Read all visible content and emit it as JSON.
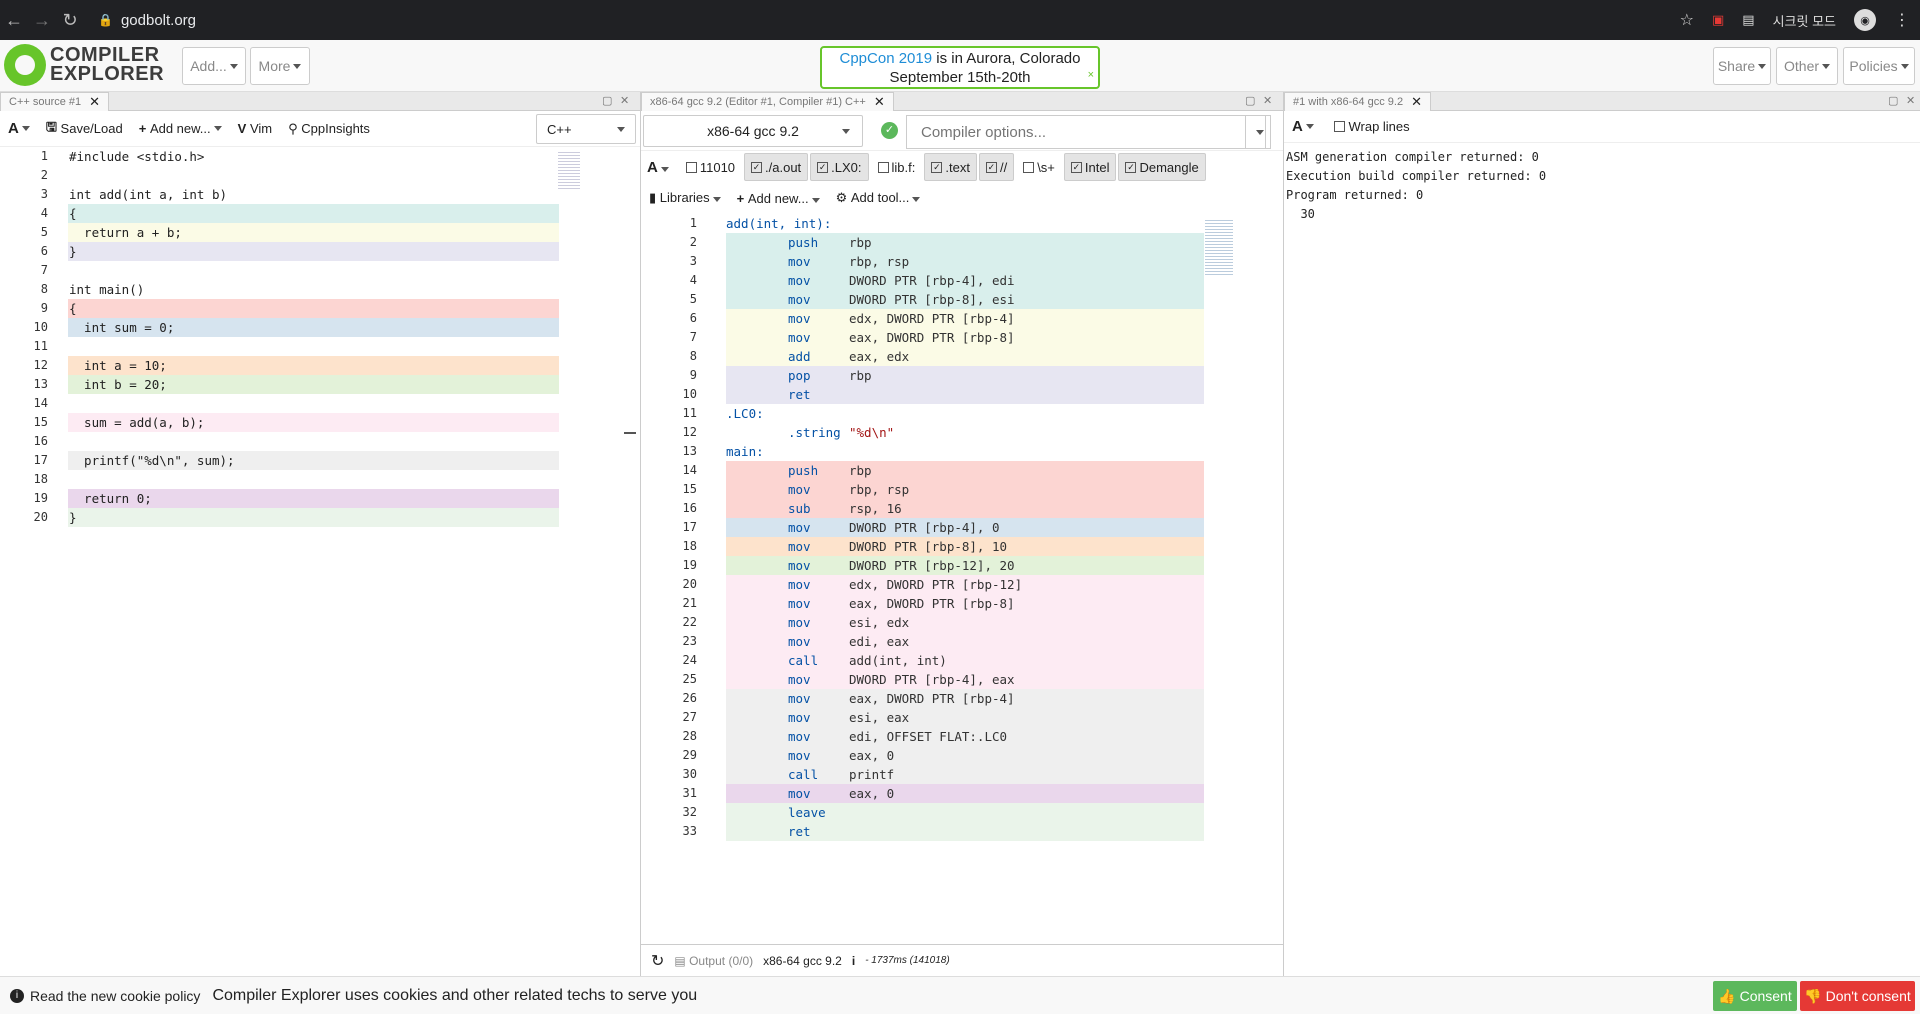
{
  "browser": {
    "url": "godbolt.org",
    "profile": "시크릿 모드"
  },
  "header": {
    "logo_top": "COMPILER",
    "logo_bottom": "EXPLORER",
    "add": "Add...",
    "more": "More",
    "banner_link": "CppCon 2019",
    "banner_rest": " is in Aurora, Colorado",
    "banner_line2": "September 15th-20th",
    "banner_close": "×",
    "share": "Share",
    "other": "Other",
    "policies": "Policies"
  },
  "source": {
    "tab": "C++ source #1",
    "font": "A",
    "save": "Save/Load",
    "addnew": "Add new...",
    "vim": "Vim",
    "insights": "CppInsights",
    "lang": "C++",
    "lines": [
      {
        "n": "1",
        "t": "#include <stdio.h>",
        "bg": ""
      },
      {
        "n": "2",
        "t": "",
        "bg": ""
      },
      {
        "n": "3",
        "t": "int add(int a, int b)",
        "bg": ""
      },
      {
        "n": "4",
        "t": "{",
        "bg": "#d9efec"
      },
      {
        "n": "5",
        "t": "  return a + b;",
        "bg": "#fbfbe6"
      },
      {
        "n": "6",
        "t": "}",
        "bg": "#e7e6f2"
      },
      {
        "n": "7",
        "t": "",
        "bg": ""
      },
      {
        "n": "8",
        "t": "int main()",
        "bg": ""
      },
      {
        "n": "9",
        "t": "{",
        "bg": "#fcd5d2"
      },
      {
        "n": "10",
        "t": "  int sum = 0;",
        "bg": "#d6e4ef"
      },
      {
        "n": "11",
        "t": "",
        "bg": ""
      },
      {
        "n": "12",
        "t": "  int a = 10;",
        "bg": "#fde3cc"
      },
      {
        "n": "13",
        "t": "  int b = 20;",
        "bg": "#e3f2d9"
      },
      {
        "n": "14",
        "t": "",
        "bg": ""
      },
      {
        "n": "15",
        "t": "  sum = add(a, b);",
        "bg": "#fdebf3"
      },
      {
        "n": "16",
        "t": "",
        "bg": ""
      },
      {
        "n": "17",
        "t": "  printf(\"%d\\n\", sum);",
        "bg": "#efefef"
      },
      {
        "n": "18",
        "t": "",
        "bg": ""
      },
      {
        "n": "19",
        "t": "  return 0;",
        "bg": "#ead7ec"
      },
      {
        "n": "20",
        "t": "}",
        "bg": "#eaf4ea"
      }
    ]
  },
  "compiler": {
    "tab": "x86-64 gcc 9.2 (Editor #1, Compiler #1) C++",
    "name": "x86-64 gcc 9.2",
    "options_placeholder": "Compiler options...",
    "filters": [
      {
        "label": "11010",
        "on": false
      },
      {
        "label": "./a.out",
        "on": true
      },
      {
        "label": ".LX0:",
        "on": true
      },
      {
        "label": "lib.f:",
        "on": false
      },
      {
        "label": ".text",
        "on": true
      },
      {
        "label": "//",
        "on": true
      },
      {
        "label": "\\s+",
        "on": false
      },
      {
        "label": "Intel",
        "on": true
      },
      {
        "label": "Demangle",
        "on": true
      }
    ],
    "libraries": "Libraries",
    "addnew": "Add new...",
    "addtool": "Add tool...",
    "asm": [
      {
        "n": "1",
        "l": "add(int, int):",
        "op": "",
        "a": "",
        "bg": ""
      },
      {
        "n": "2",
        "l": "",
        "op": "push",
        "a": "rbp",
        "bg": "#d9efec"
      },
      {
        "n": "3",
        "l": "",
        "op": "mov",
        "a": "rbp, rsp",
        "bg": "#d9efec"
      },
      {
        "n": "4",
        "l": "",
        "op": "mov",
        "a": "DWORD PTR [rbp-4], edi",
        "bg": "#d9efec"
      },
      {
        "n": "5",
        "l": "",
        "op": "mov",
        "a": "DWORD PTR [rbp-8], esi",
        "bg": "#d9efec"
      },
      {
        "n": "6",
        "l": "",
        "op": "mov",
        "a": "edx, DWORD PTR [rbp-4]",
        "bg": "#fbfbe6"
      },
      {
        "n": "7",
        "l": "",
        "op": "mov",
        "a": "eax, DWORD PTR [rbp-8]",
        "bg": "#fbfbe6"
      },
      {
        "n": "8",
        "l": "",
        "op": "add",
        "a": "eax, edx",
        "bg": "#fbfbe6"
      },
      {
        "n": "9",
        "l": "",
        "op": "pop",
        "a": "rbp",
        "bg": "#e7e6f2"
      },
      {
        "n": "10",
        "l": "",
        "op": "ret",
        "a": "",
        "bg": "#e7e6f2"
      },
      {
        "n": "11",
        "l": ".LC0:",
        "op": "",
        "a": "",
        "bg": ""
      },
      {
        "n": "12",
        "l": "",
        "op": ".string",
        "a": "\"%d\\n\"",
        "bg": ""
      },
      {
        "n": "13",
        "l": "main:",
        "op": "",
        "a": "",
        "bg": ""
      },
      {
        "n": "14",
        "l": "",
        "op": "push",
        "a": "rbp",
        "bg": "#fcd5d2"
      },
      {
        "n": "15",
        "l": "",
        "op": "mov",
        "a": "rbp, rsp",
        "bg": "#fcd5d2"
      },
      {
        "n": "16",
        "l": "",
        "op": "sub",
        "a": "rsp, 16",
        "bg": "#fcd5d2"
      },
      {
        "n": "17",
        "l": "",
        "op": "mov",
        "a": "DWORD PTR [rbp-4], 0",
        "bg": "#d6e4ef"
      },
      {
        "n": "18",
        "l": "",
        "op": "mov",
        "a": "DWORD PTR [rbp-8], 10",
        "bg": "#fde3cc"
      },
      {
        "n": "19",
        "l": "",
        "op": "mov",
        "a": "DWORD PTR [rbp-12], 20",
        "bg": "#e3f2d9"
      },
      {
        "n": "20",
        "l": "",
        "op": "mov",
        "a": "edx, DWORD PTR [rbp-12]",
        "bg": "#fdebf3"
      },
      {
        "n": "21",
        "l": "",
        "op": "mov",
        "a": "eax, DWORD PTR [rbp-8]",
        "bg": "#fdebf3"
      },
      {
        "n": "22",
        "l": "",
        "op": "mov",
        "a": "esi, edx",
        "bg": "#fdebf3"
      },
      {
        "n": "23",
        "l": "",
        "op": "mov",
        "a": "edi, eax",
        "bg": "#fdebf3"
      },
      {
        "n": "24",
        "l": "",
        "op": "call",
        "a": "add(int, int)",
        "bg": "#fdebf3"
      },
      {
        "n": "25",
        "l": "",
        "op": "mov",
        "a": "DWORD PTR [rbp-4], eax",
        "bg": "#fdebf3"
      },
      {
        "n": "26",
        "l": "",
        "op": "mov",
        "a": "eax, DWORD PTR [rbp-4]",
        "bg": "#efefef"
      },
      {
        "n": "27",
        "l": "",
        "op": "mov",
        "a": "esi, eax",
        "bg": "#efefef"
      },
      {
        "n": "28",
        "l": "",
        "op": "mov",
        "a": "edi, OFFSET FLAT:.LC0",
        "bg": "#efefef"
      },
      {
        "n": "29",
        "l": "",
        "op": "mov",
        "a": "eax, 0",
        "bg": "#efefef"
      },
      {
        "n": "30",
        "l": "",
        "op": "call",
        "a": "printf",
        "bg": "#efefef"
      },
      {
        "n": "31",
        "l": "",
        "op": "mov",
        "a": "eax, 0",
        "bg": "#ead7ec"
      },
      {
        "n": "32",
        "l": "",
        "op": "leave",
        "a": "",
        "bg": "#eaf4ea"
      },
      {
        "n": "33",
        "l": "",
        "op": "ret",
        "a": "",
        "bg": "#eaf4ea"
      }
    ],
    "footer_output": "Output (0/0)",
    "footer_name": "x86-64 gcc 9.2",
    "footer_time": "- 1737ms (141018)"
  },
  "exec": {
    "tab": "#1 with x86-64 gcc 9.2",
    "font": "A",
    "wrap": "Wrap lines",
    "output": [
      "ASM generation compiler returned: 0",
      "Execution build compiler returned: 0",
      "Program returned: 0",
      "  30"
    ]
  },
  "cookie": {
    "link": "Read the new cookie policy",
    "text": "Compiler Explorer uses cookies and other related techs to serve you",
    "consent": "Consent",
    "dont": "Don't consent"
  },
  "colors": {
    "brand": "#67c52a",
    "link": "#1f8dd6",
    "consent": "#5cb85c",
    "dont": "#e53935"
  }
}
